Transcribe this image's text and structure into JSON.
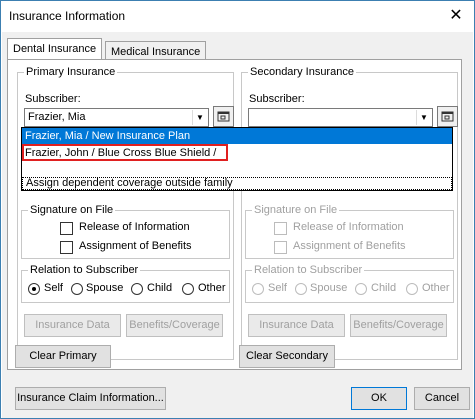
{
  "window": {
    "title": "Insurance Information",
    "close_glyph": "✕"
  },
  "tabs": [
    {
      "label": "Dental Insurance"
    },
    {
      "label": "Medical Insurance"
    }
  ],
  "primary": {
    "group_label": "Primary Insurance",
    "subscriber_label": "Subscriber:",
    "subscriber_value": "Frazier, Mia",
    "signature_group": "Signature on File",
    "release_label": "Release of Information",
    "assignment_label": "Assignment of Benefits",
    "relation_group": "Relation to Subscriber",
    "relation_options": [
      "Self",
      "Spouse",
      "Child",
      "Other"
    ],
    "relation_selected": "Self",
    "insurance_data_btn": "Insurance Data",
    "benefits_btn": "Benefits/Coverage",
    "clear_btn": "Clear Primary"
  },
  "secondary": {
    "group_label": "Secondary Insurance",
    "subscriber_label": "Subscriber:",
    "subscriber_value": "",
    "signature_group": "Signature on File",
    "release_label": "Release of Information",
    "assignment_label": "Assignment of Benefits",
    "relation_group": "Relation to Subscriber",
    "relation_options": [
      "Self",
      "Spouse",
      "Child",
      "Other"
    ],
    "insurance_data_btn": "Insurance Data",
    "benefits_btn": "Benefits/Coverage",
    "clear_btn": "Clear Secondary"
  },
  "dropdown": {
    "items": [
      "Frazier, Mia  / New Insurance Plan",
      "Frazier, John  / Blue Cross Blue Shield /"
    ],
    "assign_option": "Assign dependent coverage outside family"
  },
  "footer": {
    "claim_btn": "Insurance Claim Information...",
    "ok_btn": "OK",
    "cancel_btn": "Cancel"
  }
}
